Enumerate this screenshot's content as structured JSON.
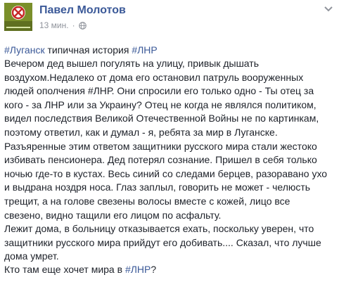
{
  "post": {
    "author": "Павел Молотов",
    "time": "13 мин.",
    "meta_separator": "·",
    "privacy_icon": "globe-icon",
    "options_icon": "chevron-down-icon",
    "hashtag_line": {
      "tag1": "#Луганск",
      "text": " типичная история ",
      "tag2": "#ЛНР"
    },
    "body_lines": [
      "Вечером дед вышел погулять на улицу, привык дышать",
      "воздухом.Недалеко от дома его остановил патруль вооруженных",
      "людей ополчения #ЛНР. Они спросили его только одно - Ты отец за",
      "кого - за ЛНР или за Украину? Отец не когда не являлся политиком,",
      "видел последствия Великой Отечественной Войны не по картинкам,",
      "поэтому ответил, как и думал - я, ребята за мир в Луганске.",
      "Разъяренные этим ответом защитники русского мира стали жестоко",
      "избивать пенсионера. Дед потерял сознание. Пришел в себя только",
      "ночью где-то в кустах. Весь синий со следами берцев, разоравано ухо",
      "и выдрана ноздря носа. Глаз заплыл, говорить не может - челюсть",
      "трещит, а на голове свезены волосы вместе с кожей, лицо все",
      "свезено, видно тащили его лицом по асфальту.",
      "Лежит дома, в больницу отказывается ехать, поскольку уверен, что",
      "защитники русского мира прийдут его добивать.... Сказал, что лучше",
      "дома умрет."
    ],
    "closing_line": {
      "text": "Кто там еще хочет мира в ",
      "tag": "#ЛНР",
      "end": "?"
    }
  },
  "colors": {
    "link": "#3b5998",
    "text": "#1d2129",
    "meta": "#90949c"
  }
}
